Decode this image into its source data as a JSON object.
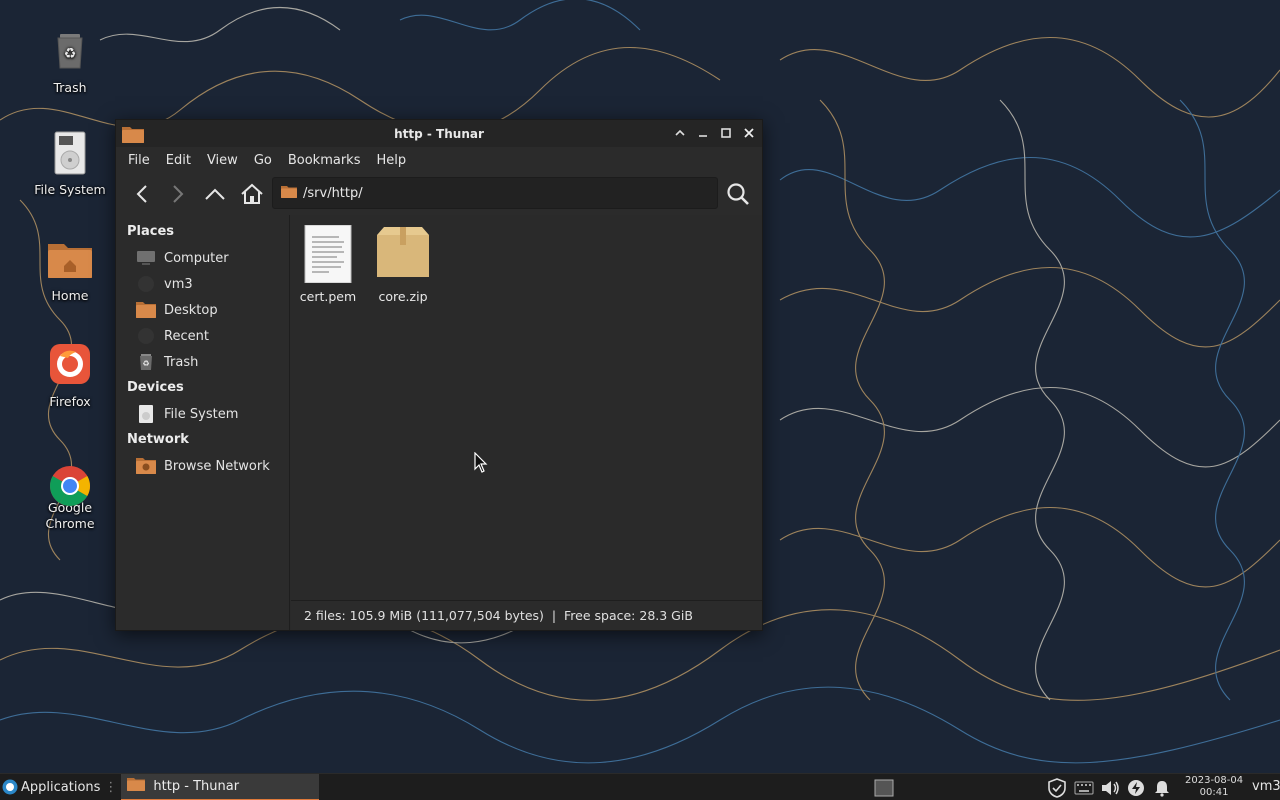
{
  "desktop": {
    "icons": [
      {
        "label": "Trash"
      },
      {
        "label": "File System"
      },
      {
        "label": "Home"
      },
      {
        "label": "Firefox"
      },
      {
        "label": "Google\nChrome"
      }
    ]
  },
  "window": {
    "title": "http - Thunar",
    "menu": [
      "File",
      "Edit",
      "View",
      "Go",
      "Bookmarks",
      "Help"
    ],
    "path": "/srv/http/",
    "sidebar": {
      "places_header": "Places",
      "places": [
        "Computer",
        "vm3",
        "Desktop",
        "Recent",
        "Trash"
      ],
      "devices_header": "Devices",
      "devices": [
        "File System"
      ],
      "network_header": "Network",
      "network": [
        "Browse Network"
      ]
    },
    "files": [
      {
        "name": "cert.pem",
        "icon": "text-file-icon"
      },
      {
        "name": "core.zip",
        "icon": "archive-icon"
      }
    ],
    "status": "2 files: 105.9 MiB (111,077,504 bytes)  |  Free space: 28.3 GiB"
  },
  "taskbar": {
    "applications_label": "Applications",
    "task_label": "http - Thunar",
    "date": "2023-08-04",
    "time": "00:41",
    "user": "vm3"
  },
  "colors": {
    "accent": "#e07a3a",
    "folder": "#d8894a",
    "window_bg": "#2b2b2b",
    "desktop_bg": "#1b2535"
  }
}
